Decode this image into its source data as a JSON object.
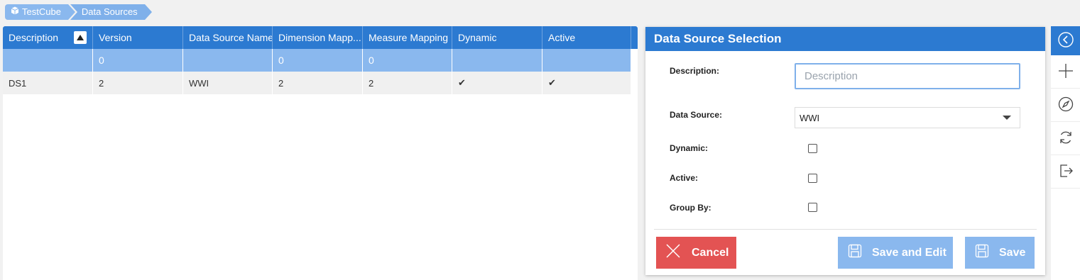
{
  "breadcrumb": {
    "items": [
      {
        "label": "TestCube"
      },
      {
        "label": "Data Sources"
      }
    ]
  },
  "grid": {
    "columns": [
      "Description",
      "Version",
      "Data Source Name",
      "Dimension Mapp...",
      "Measure Mapping",
      "Dynamic",
      "Active"
    ],
    "filter_row": [
      "",
      "0",
      "",
      "0",
      "0",
      "",
      ""
    ],
    "rows": [
      {
        "description": "DS1",
        "version": "2",
        "data_source_name": "WWI",
        "dimension_mapping": "2",
        "measure_mapping": "2",
        "dynamic": "✔",
        "active": "✔"
      }
    ]
  },
  "panel": {
    "title": "Data Source Selection",
    "description_label": "Description:",
    "description_placeholder": "Description",
    "description_value": "",
    "data_source_label": "Data Source:",
    "data_source_value": "WWI",
    "dynamic_label": "Dynamic:",
    "active_label": "Active:",
    "group_by_label": "Group By:",
    "cancel_label": "Cancel",
    "save_and_edit_label": "Save and Edit",
    "save_label": "Save"
  },
  "colors": {
    "primary": "#2c7ad1",
    "light_primary": "#8ab8ee",
    "danger": "#e35353"
  },
  "side_toolbar": [
    "collapse-icon",
    "add-icon",
    "compass-icon",
    "refresh-icon",
    "exit-icon"
  ]
}
